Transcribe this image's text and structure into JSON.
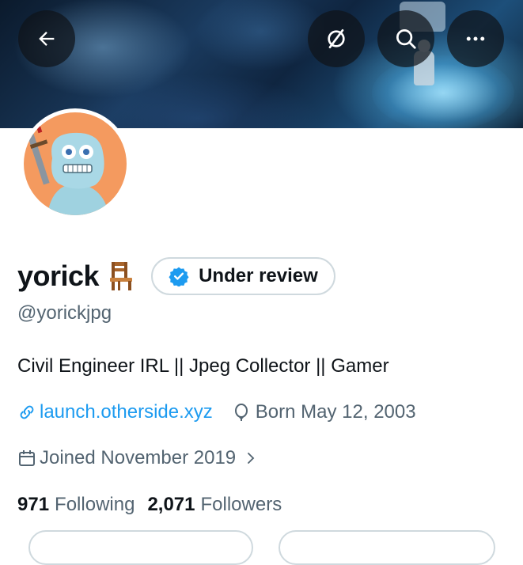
{
  "header": {
    "back_icon": "arrow-left-icon",
    "mute_icon": "slashed-circle-icon",
    "search_icon": "search-icon",
    "more_icon": "more-horizontal-icon"
  },
  "profile": {
    "name": "yorick",
    "name_emoji": "chair",
    "verification_label": "Under review",
    "handle": "@yorickjpg",
    "bio": "Civil Engineer IRL || Jpeg Collector || Gamer",
    "website": "launch.otherside.xyz",
    "birthday": "Born May 12, 2003",
    "joined": "Joined November 2019",
    "following_count": "971",
    "following_label": "Following",
    "followers_count": "2,071",
    "followers_label": "Followers"
  },
  "colors": {
    "link": "#1d9bf0",
    "muted_text": "#536471",
    "verified_badge": "#1d9bf0",
    "avatar_background": "#f49a5f"
  }
}
